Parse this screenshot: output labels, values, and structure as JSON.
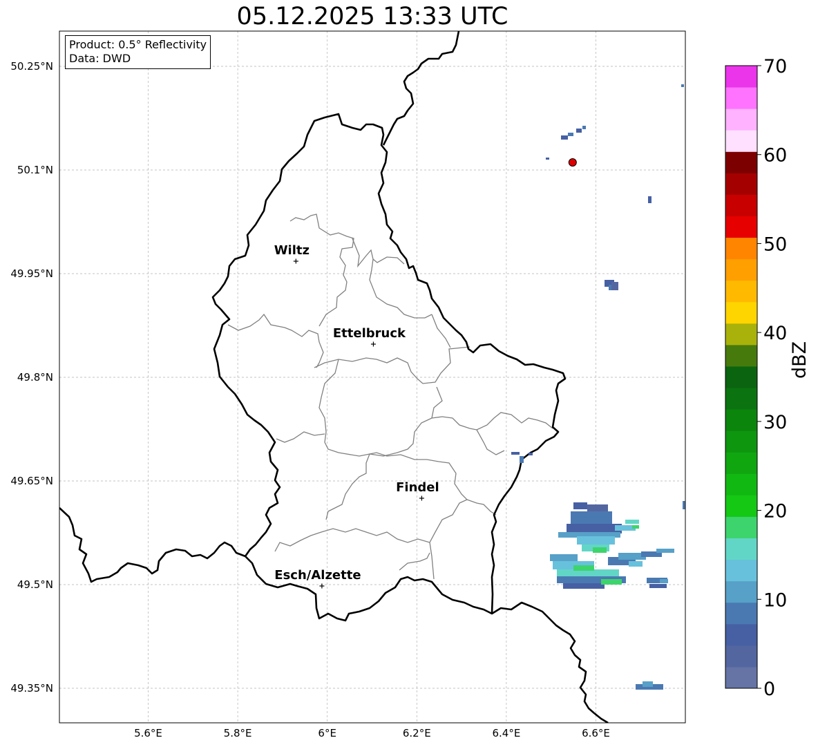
{
  "title": "05.12.2025 13:33 UTC",
  "info_box": {
    "product": "Product: 0.5° Reflectivity",
    "data_source": "Data: DWD"
  },
  "map": {
    "lon_ticks": [
      {
        "value": 5.6,
        "label": "5.6°E"
      },
      {
        "value": 5.8,
        "label": "5.8°E"
      },
      {
        "value": 6.0,
        "label": "6°E"
      },
      {
        "value": 6.2,
        "label": "6.2°E"
      },
      {
        "value": 6.4,
        "label": "6.4°E"
      },
      {
        "value": 6.6,
        "label": "6.6°E"
      }
    ],
    "lat_ticks": [
      {
        "value": 50.25,
        "label": "50.25°N"
      },
      {
        "value": 50.1,
        "label": "50.1°N"
      },
      {
        "value": 49.95,
        "label": "49.95°N"
      },
      {
        "value": 49.8,
        "label": "49.8°N"
      },
      {
        "value": 49.65,
        "label": "49.65°N"
      },
      {
        "value": 49.5,
        "label": "49.5°N"
      },
      {
        "value": 49.35,
        "label": "49.35°N"
      }
    ],
    "cities": [
      {
        "name": "Wiltz",
        "lon": 5.93,
        "lat": 49.968
      },
      {
        "name": "Ettelbruck",
        "lon": 6.103,
        "lat": 49.848
      },
      {
        "name": "Findel",
        "lon": 6.211,
        "lat": 49.625
      },
      {
        "name": "Esch/Alzette",
        "lon": 5.988,
        "lat": 49.498
      }
    ],
    "radar_site": {
      "lon": 6.548,
      "lat": 50.111,
      "color": "#e00000"
    }
  },
  "colorbar": {
    "label": "dBZ",
    "ticks": [
      "0",
      "10",
      "20",
      "30",
      "40",
      "50",
      "60",
      "70"
    ],
    "colors": [
      "#6573a5",
      "#5466a0",
      "#4660a3",
      "#4a79b2",
      "#57a0c8",
      "#67c1dc",
      "#62d6c6",
      "#3dd46d",
      "#14c814",
      "#12b812",
      "#10a610",
      "#0e960e",
      "#0c850c",
      "#0b7410",
      "#0b6410",
      "#467a0d",
      "#a9b20a",
      "#ffd500",
      "#ffba00",
      "#ff9f00",
      "#ff8500",
      "#e60000",
      "#c80000",
      "#a50000",
      "#7d0000",
      "#ffe0ff",
      "#ffb2ff",
      "#ff73ff",
      "#ea35ea"
    ]
  }
}
